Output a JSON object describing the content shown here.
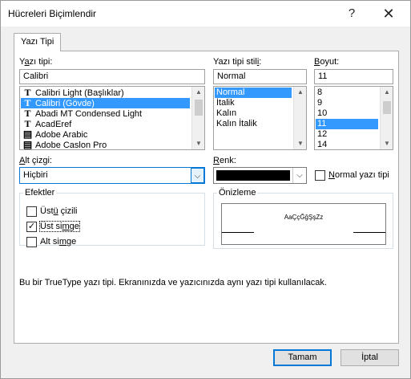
{
  "window": {
    "title": "Hücreleri Biçimlendir",
    "help_glyph": "?",
    "close_glyph": "✕"
  },
  "tab": {
    "label": "Yazı Tipi"
  },
  "font": {
    "label_pre": "Y",
    "label_u": "a",
    "label_post": "zı tipi:",
    "value": "Calibri",
    "items": [
      {
        "name": "Calibri Light (Başlıklar)",
        "icon": "truetype-icon",
        "selected": false
      },
      {
        "name": "Calibri (Gövde)",
        "icon": "truetype-icon",
        "selected": true
      },
      {
        "name": "Abadi MT Condensed Light",
        "icon": "truetype-icon",
        "selected": false
      },
      {
        "name": "AcadEref",
        "icon": "truetype-icon",
        "selected": false
      },
      {
        "name": "Adobe Arabic",
        "icon": "opentype-icon",
        "selected": false
      },
      {
        "name": "Adobe Caslon Pro",
        "icon": "opentype-icon",
        "selected": false
      }
    ]
  },
  "style": {
    "label_pre": "Yazı tipi stil",
    "label_u": "i",
    "label_post": ":",
    "value": "Normal",
    "items": [
      {
        "name": "Normal",
        "selected": true
      },
      {
        "name": "İtalik",
        "selected": false
      },
      {
        "name": "Kalın",
        "selected": false
      },
      {
        "name": "Kalın İtalik",
        "selected": false
      }
    ]
  },
  "size": {
    "label_pre": "",
    "label_u": "B",
    "label_post": "oyut:",
    "value": "11",
    "items": [
      {
        "name": "8",
        "selected": false
      },
      {
        "name": "9",
        "selected": false
      },
      {
        "name": "10",
        "selected": false
      },
      {
        "name": "11",
        "selected": true
      },
      {
        "name": "12",
        "selected": false
      },
      {
        "name": "14",
        "selected": false
      }
    ]
  },
  "underline": {
    "label_pre": "",
    "label_u": "A",
    "label_post": "lt çizgi:",
    "value": "Hiçbiri"
  },
  "color": {
    "label_pre": "",
    "label_u": "R",
    "label_post": "enk:",
    "swatch": "#000000",
    "normal_pre": "",
    "normal_u": "N",
    "normal_post": "ormal yazı tipi",
    "normal_checked": false
  },
  "effects": {
    "title": "Efektler",
    "items": [
      {
        "pre": "Üst",
        "u": "ü",
        "post": " çizili",
        "checked": false
      },
      {
        "pre": "Üst si",
        "u": "m",
        "post": "ge",
        "checked": true
      },
      {
        "pre": "Alt si",
        "u": "m",
        "post": "ge",
        "checked": false
      }
    ]
  },
  "preview": {
    "title": "Önizleme",
    "sample": "AaÇçĞğŞşZz"
  },
  "info_text": "Bu bir TrueType yazı tipi. Ekranınızda ve yazıcınızda aynı yazı tipi kullanılacak.",
  "buttons": {
    "ok": "Tamam",
    "cancel": "İptal"
  },
  "colors": {
    "selection": "#3399ff",
    "focus": "#0078d7"
  }
}
